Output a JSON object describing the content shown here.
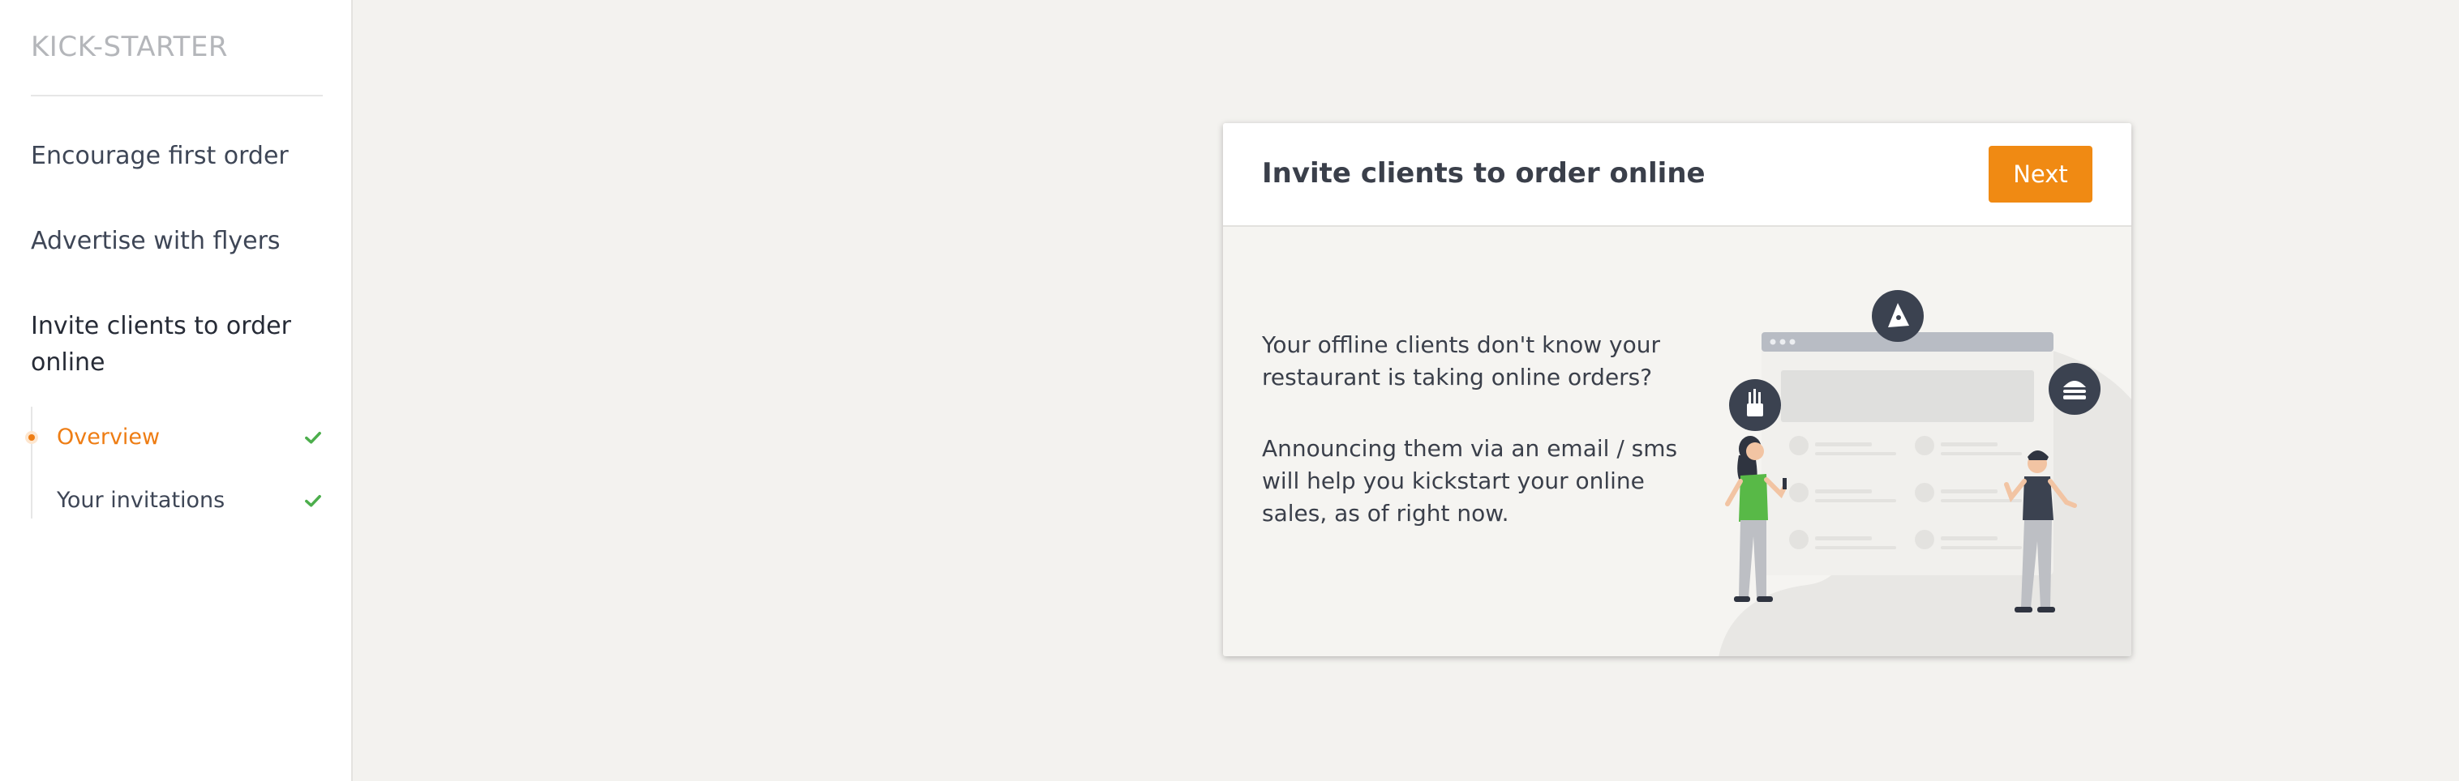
{
  "sidebar": {
    "brand": "KICK-STARTER",
    "items": [
      {
        "label": "Encourage first order"
      },
      {
        "label": "Advertise with flyers"
      },
      {
        "label": "Invite clients to order online"
      }
    ],
    "subitems": [
      {
        "label": "Overview",
        "state": "current",
        "completed": true
      },
      {
        "label": "Your invitations",
        "state": "normal",
        "completed": true
      }
    ]
  },
  "card": {
    "title": "Invite clients to order online",
    "next_label": "Next",
    "paragraph_1": "Your offline clients don't know your restaurant is taking online orders?",
    "paragraph_2": "Announcing them via an email / sms will help you kickstart your online sales, as of right now.",
    "illustration_icons": [
      "pizza-icon",
      "fries-icon",
      "burger-icon"
    ]
  },
  "colors": {
    "accent": "#f08a13",
    "check": "#4cae4c",
    "background": "#f3f2ef"
  }
}
